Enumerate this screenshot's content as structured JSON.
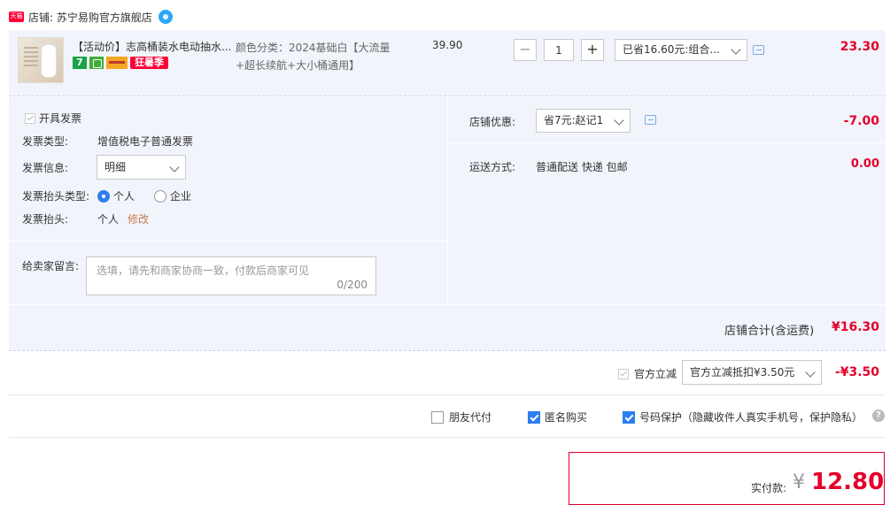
{
  "shop": {
    "logo_text": "天猫",
    "name": "店铺: 苏宁易购官方旗舰店",
    "chat_icon": "wangwang-icon"
  },
  "item": {
    "title": "【活动价】志高桶装水电动抽水...",
    "badges": {
      "seven": "7",
      "sale": "狂暑季"
    },
    "sku": "颜色分类：2024基础白【大流量+超长续航+大小桶通用】",
    "unit_price": "39.90",
    "qty": {
      "minus": "−",
      "value": "1",
      "plus": "+"
    },
    "promo_select": "已省16.60元:组合...",
    "subtotal": "23.30"
  },
  "invoice": {
    "checkbox_label": "开具发票",
    "type_label": "发票类型:",
    "type_value": "增值税电子普通发票",
    "info_label": "发票信息:",
    "info_select": "明细",
    "header_type_label": "发票抬头类型:",
    "header_type_options": [
      "个人",
      "企业"
    ],
    "header_label": "发票抬头:",
    "header_value": "个人",
    "header_edit": "修改"
  },
  "message": {
    "label": "给卖家留言:",
    "placeholder": "选填，请先和商家协商一致，付款后商家可见",
    "count": "0/200"
  },
  "shop_discount": {
    "label": "店铺优惠:",
    "select": "省7元:赵记1",
    "amount": "-7.00"
  },
  "shipping": {
    "label": "运送方式:",
    "value": "普通配送 快递 包邮",
    "amount": "0.00"
  },
  "shop_total": {
    "label": "店铺合计(含运费)",
    "amount": "¥16.30"
  },
  "official": {
    "checkbox_label": "官方立减",
    "select": "官方立减抵扣¥3.50元",
    "amount": "-¥3.50"
  },
  "options": {
    "friend_pay": "朋友代付",
    "anonymous": "匿名购买",
    "privacy": "号码保护（隐藏收件人真实手机号，保护隐私）",
    "help": "?"
  },
  "final": {
    "label": "实付款:",
    "currency": "¥",
    "amount": "12.80"
  },
  "colors": {
    "accent_red": "#e4002b",
    "band_bg": "#f1f4fb",
    "checkbox_blue": "#2e7ff0"
  }
}
